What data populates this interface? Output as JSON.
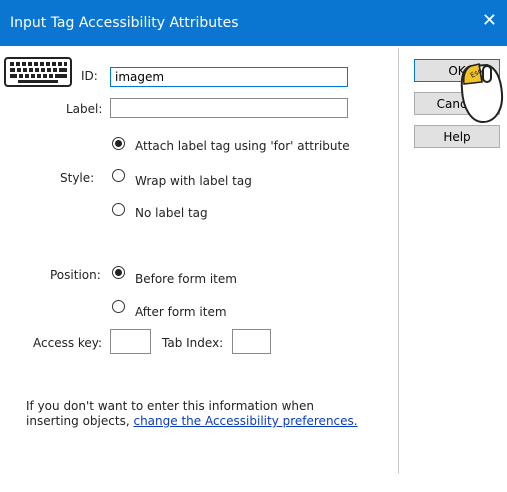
{
  "window": {
    "title": "Input Tag Accessibility Attributes",
    "close_glyph": "✕"
  },
  "fields": {
    "id_label": "ID:",
    "id_value": "imagem",
    "label_label": "Label:",
    "label_value": "",
    "style_label": "Style:",
    "position_label": "Position:",
    "access_key_label": "Access key:",
    "access_key_value": "",
    "tab_index_label": "Tab Index:",
    "tab_index_value": ""
  },
  "style_options": [
    {
      "label": "Attach label tag using 'for' attribute",
      "checked": true
    },
    {
      "label": "Wrap with label tag",
      "checked": false
    },
    {
      "label": "No label tag",
      "checked": false
    }
  ],
  "position_options": [
    {
      "label": "Before form item",
      "checked": true
    },
    {
      "label": "After form item",
      "checked": false
    }
  ],
  "buttons": {
    "ok": "OK",
    "cancel": "Cancel",
    "help": "Help"
  },
  "footer": {
    "text": "If you don't want to enter this information when inserting objects,",
    "line1": "If you don't want to enter this information when",
    "line2_prefix": "inserting objects,",
    "link": "change the Accessibility preferences."
  },
  "icons": {
    "keyboard": "keyboard-icon",
    "mouse": "mouse-click-icon",
    "mouse_badge": "Esq"
  },
  "colors": {
    "titlebar": "#0a76d1",
    "link": "#0b3bbf",
    "focus": "#0078d7"
  }
}
